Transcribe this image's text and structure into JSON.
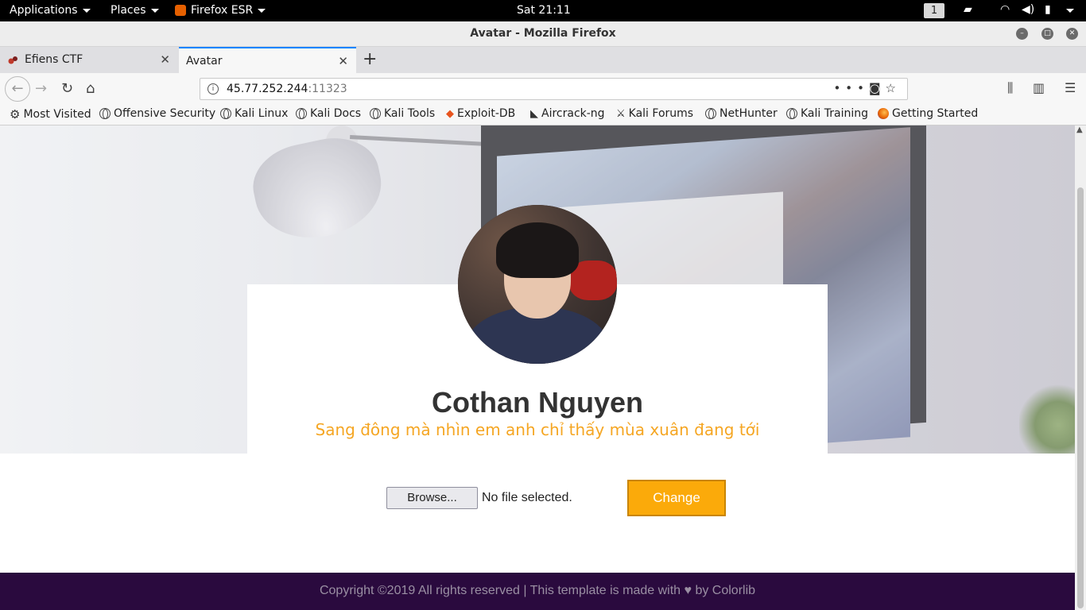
{
  "topbar": {
    "applications": "Applications",
    "places": "Places",
    "firefox": "Firefox ESR",
    "clock": "Sat 21:11",
    "workspace": "1"
  },
  "window": {
    "title": "Avatar - Mozilla Firefox"
  },
  "tabs": [
    {
      "label": "Efiens CTF",
      "active": false
    },
    {
      "label": "Avatar",
      "active": true
    }
  ],
  "url": {
    "host": "45.77.252.244",
    "port": ":11323"
  },
  "bookmarks": [
    {
      "label": "Most Visited",
      "icon": "gear-icon"
    },
    {
      "label": "Offensive Security",
      "icon": "globe-icon"
    },
    {
      "label": "Kali Linux",
      "icon": "globe-icon"
    },
    {
      "label": "Kali Docs",
      "icon": "globe-icon"
    },
    {
      "label": "Kali Tools",
      "icon": "globe-icon"
    },
    {
      "label": "Exploit-DB",
      "icon": "exploitdb-icon"
    },
    {
      "label": "Aircrack-ng",
      "icon": "aircrack-icon"
    },
    {
      "label": "Kali Forums",
      "icon": "kali-icon"
    },
    {
      "label": "NetHunter",
      "icon": "globe-icon"
    },
    {
      "label": "Kali Training",
      "icon": "globe-icon"
    },
    {
      "label": "Getting Started",
      "icon": "firefox-icon"
    }
  ],
  "profile": {
    "name": "Cothan Nguyen",
    "tagline": "Sang đông mà nhìn em anh chỉ thấy mùa xuân đang tới"
  },
  "upload": {
    "browse_label": "Browse...",
    "status": "No file selected.",
    "change_label": "Change"
  },
  "footer": {
    "copyright": "Copyright ©2019 All rights reserved | This template is made with ♥ by Colorlib"
  },
  "colors": {
    "accent": "#fbaa0a",
    "tagline": "#f5a623",
    "footer_bg": "#2a0a3e",
    "active_tab": "#0a84ff"
  }
}
